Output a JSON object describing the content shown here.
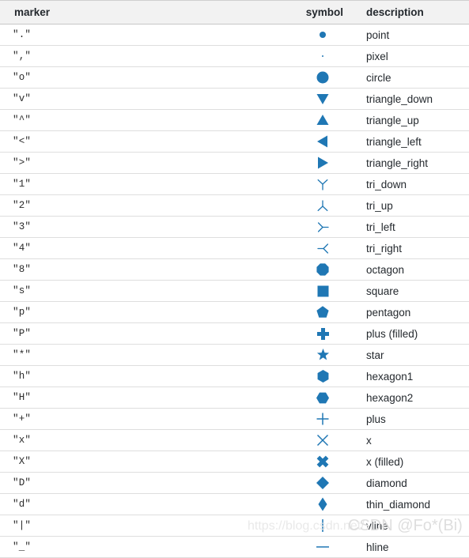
{
  "table": {
    "headers": {
      "marker": "marker",
      "symbol": "symbol",
      "description": "description"
    },
    "colors": {
      "marker_blue": "#1f77b4",
      "header_background": "#f2f2f2",
      "row_border": "#dedede",
      "text": "#24292e"
    },
    "rows": [
      {
        "marker": "\".\"",
        "symbol": "point",
        "description": "point"
      },
      {
        "marker": "\",\"",
        "symbol": "pixel",
        "description": "pixel"
      },
      {
        "marker": "\"o\"",
        "symbol": "circle",
        "description": "circle"
      },
      {
        "marker": "\"v\"",
        "symbol": "triangle_down",
        "description": "triangle_down"
      },
      {
        "marker": "\"^\"",
        "symbol": "triangle_up",
        "description": "triangle_up"
      },
      {
        "marker": "\"<\"",
        "symbol": "triangle_left",
        "description": "triangle_left"
      },
      {
        "marker": "\">\"",
        "symbol": "triangle_right",
        "description": "triangle_right"
      },
      {
        "marker": "\"1\"",
        "symbol": "tri_down",
        "description": "tri_down"
      },
      {
        "marker": "\"2\"",
        "symbol": "tri_up",
        "description": "tri_up"
      },
      {
        "marker": "\"3\"",
        "symbol": "tri_left",
        "description": "tri_left"
      },
      {
        "marker": "\"4\"",
        "symbol": "tri_right",
        "description": "tri_right"
      },
      {
        "marker": "\"8\"",
        "symbol": "octagon",
        "description": "octagon"
      },
      {
        "marker": "\"s\"",
        "symbol": "square",
        "description": "square"
      },
      {
        "marker": "\"p\"",
        "symbol": "pentagon",
        "description": "pentagon"
      },
      {
        "marker": "\"P\"",
        "symbol": "plus_filled",
        "description": "plus (filled)"
      },
      {
        "marker": "\"*\"",
        "symbol": "star",
        "description": "star"
      },
      {
        "marker": "\"h\"",
        "symbol": "hexagon1",
        "description": "hexagon1"
      },
      {
        "marker": "\"H\"",
        "symbol": "hexagon2",
        "description": "hexagon2"
      },
      {
        "marker": "\"+\"",
        "symbol": "plus",
        "description": "plus"
      },
      {
        "marker": "\"x\"",
        "symbol": "x",
        "description": "x"
      },
      {
        "marker": "\"X\"",
        "symbol": "x_filled",
        "description": "x (filled)"
      },
      {
        "marker": "\"D\"",
        "symbol": "diamond",
        "description": "diamond"
      },
      {
        "marker": "\"d\"",
        "symbol": "thin_diamond",
        "description": "thin_diamond"
      },
      {
        "marker": "\"|\"",
        "symbol": "vline",
        "description": "vline"
      },
      {
        "marker": "\"_\"",
        "symbol": "hline",
        "description": "hline"
      }
    ]
  },
  "watermark": {
    "url": "https://blog.csdn.net/",
    "brand": "CSDN @Fo*(Bi)"
  }
}
